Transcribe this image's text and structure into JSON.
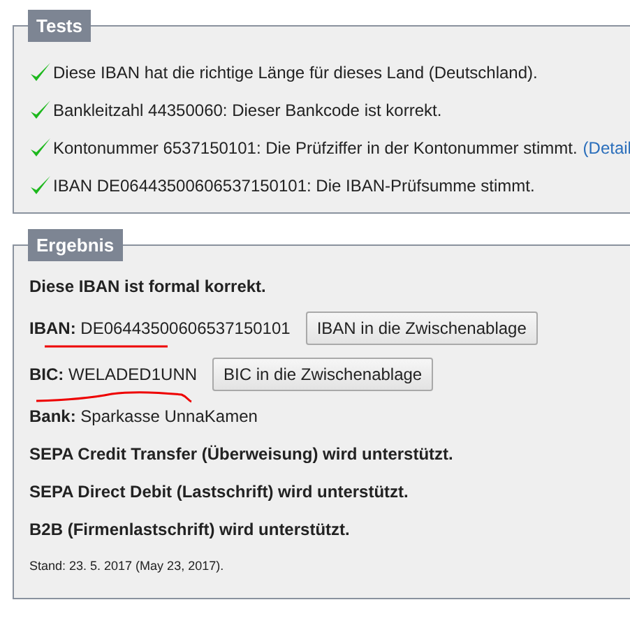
{
  "tests": {
    "legend": "Tests",
    "items": [
      {
        "passed": true,
        "text": "Diese IBAN hat die richtige Länge für dieses Land (Deutschland)."
      },
      {
        "passed": true,
        "text": "Bankleitzahl 44350060: Dieser Bankcode ist korrekt."
      },
      {
        "passed": true,
        "text": "Kontonummer 6537150101: Die Prüfziffer in der Kontonummer stimmt.",
        "link": "(Detail"
      },
      {
        "passed": true,
        "text": "IBAN DE06443500606537150101: Die IBAN-Prüfsumme stimmt."
      }
    ]
  },
  "result": {
    "legend": "Ergebnis",
    "summary": "Diese IBAN ist formal korrekt.",
    "iban": {
      "label": "IBAN:",
      "value": "DE06443500606537150101",
      "button": "IBAN in die Zwischenablage"
    },
    "bic": {
      "label": "BIC:",
      "value": "WELADED1UNN",
      "button": "BIC in die Zwischenablage"
    },
    "bank": {
      "label": "Bank:",
      "value": "Sparkasse UnnaKamen"
    },
    "features": [
      "SEPA Credit Transfer (Überweisung) wird unterstützt.",
      "SEPA Direct Debit (Lastschrift) wird unterstützt.",
      "B2B (Firmenlastschrift) wird unterstützt."
    ],
    "stand": "Stand: 23. 5. 2017 (May 23, 2017)."
  }
}
